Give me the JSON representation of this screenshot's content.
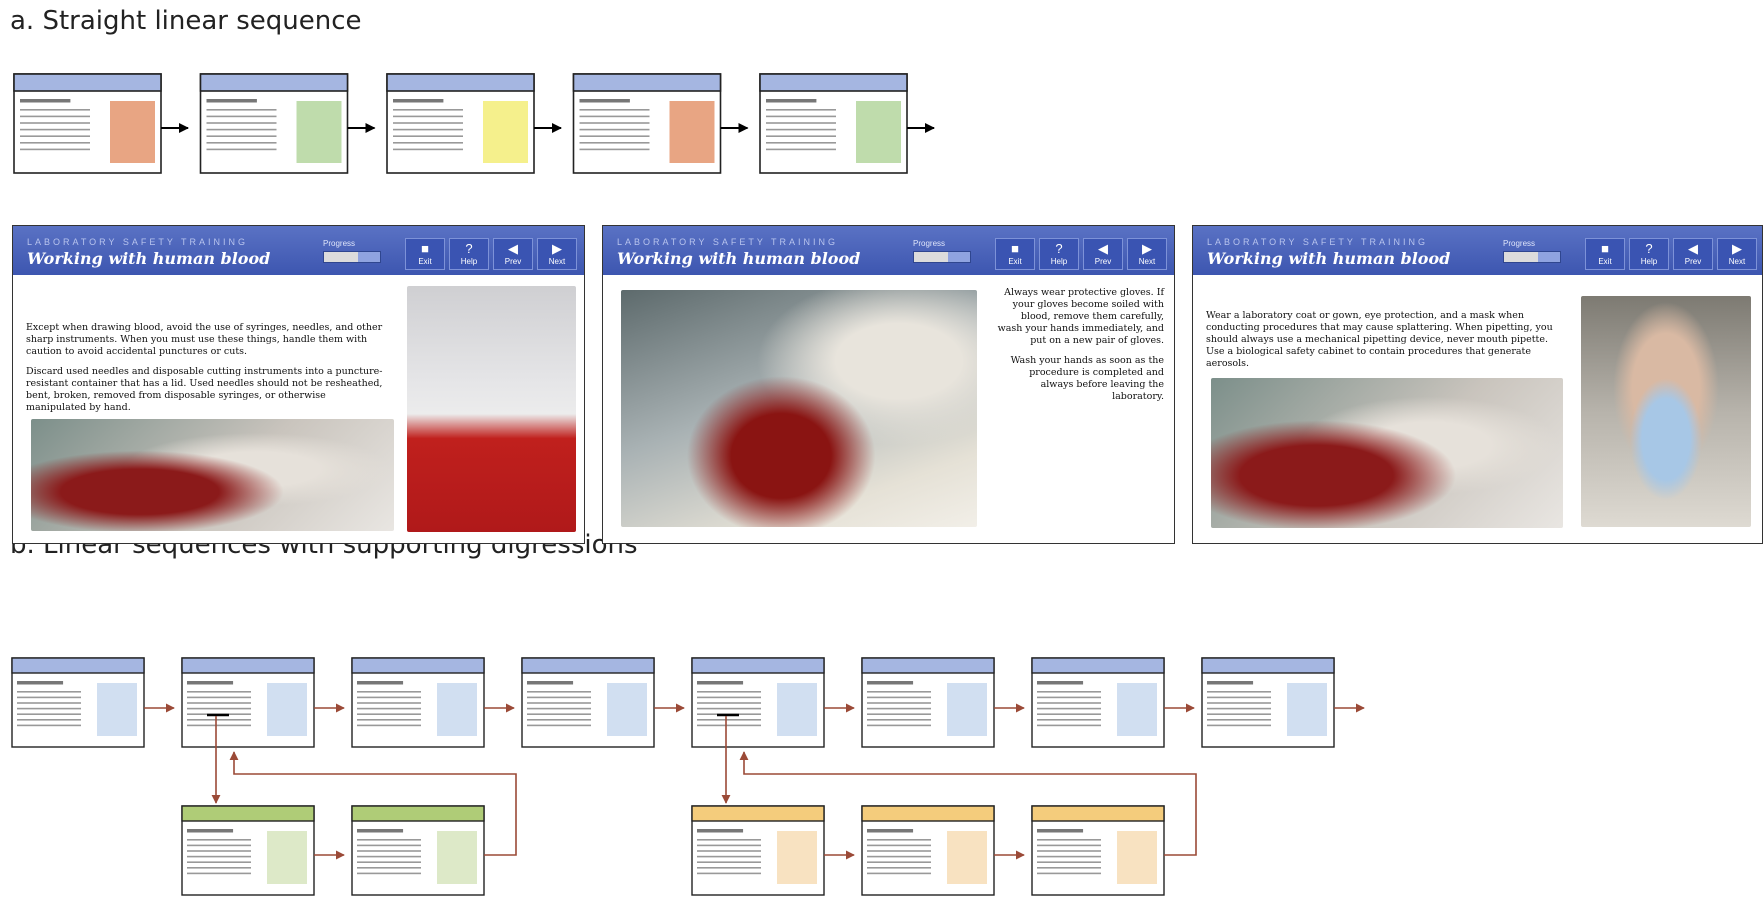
{
  "headings": {
    "a": "a. Straight linear sequence",
    "b": "b. Linear sequences with supporting digressions"
  },
  "colors": {
    "header_blue": "#a5b6e1",
    "mock_orange": "#e8a583",
    "mock_green": "#bfdcac",
    "mock_yellow": "#f5f08c",
    "light_blue": "#d1dff1",
    "digression_green": "#afcc77",
    "digression_green_light": "#dde9c8",
    "digression_orange": "#f4cc7c",
    "digression_orange_light": "#f8e2c1",
    "arrow_black": "#000000",
    "arrow_brown": "#9b4a37"
  },
  "sequence_a": [
    "mock_orange",
    "mock_green",
    "mock_yellow",
    "mock_orange",
    "mock_green"
  ],
  "sequence_b": {
    "main_count": 8,
    "digression_1": {
      "from": 2,
      "count": 2,
      "color": "digression_green"
    },
    "digression_2": {
      "from": 5,
      "count": 3,
      "color": "digression_orange"
    }
  },
  "app": {
    "subtitle": "LABORATORY SAFETY TRAINING",
    "title": "Working with human blood",
    "progress_label": "Progress",
    "buttons": [
      {
        "icon": "stop-icon",
        "label": "Exit"
      },
      {
        "icon": "question-icon",
        "label": "Help"
      },
      {
        "icon": "prev-arrow-icon",
        "label": "Prev"
      },
      {
        "icon": "next-arrow-icon",
        "label": "Next"
      }
    ]
  },
  "screens": [
    {
      "progress": 0.6,
      "paragraphs": [
        "Except when drawing blood, avoid the use of syringes, needles, and other sharp instruments. When you must use these things, handle them with caution to avoid accidental punctures or cuts.",
        "Discard used needles and disposable cutting instruments into a puncture-resistant container that has a lid. Used needles should not be resheathed, bent, broken, removed from disposable syringes, or otherwise manipulated by hand."
      ],
      "photo_1": "blood-bag-photo",
      "photo_2": "sharps-container-photo"
    },
    {
      "progress": 0.6,
      "paragraphs": [
        "Always wear protective gloves. If your gloves become soiled with blood, remove them carefully, wash your hands immediately, and put on a new pair of gloves.",
        "Wash your hands as soon as the procedure is completed and always before leaving the laboratory."
      ],
      "photo_1": "blood-tubes-photo"
    },
    {
      "progress": 0.6,
      "paragraphs": [
        "Wear a laboratory coat or gown, eye protection, and a mask when conducting procedures that may cause splattering. When pipetting, you should always use a mechanical pipetting device, never mouth pipette. Use a biological safety cabinet to contain procedures that generate aerosols."
      ],
      "photo_1": "blood-bag-photo",
      "photo_2": "goggles-mask-photo"
    }
  ]
}
